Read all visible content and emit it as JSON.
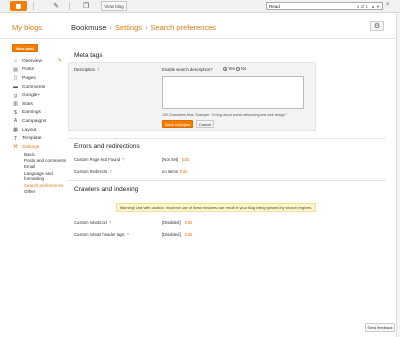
{
  "topbar": {
    "view_blog": "View blog",
    "find_value": "Read",
    "find_count": "1 of 1"
  },
  "header": {
    "my_blogs": "My blogs",
    "blog_name": "Bookmuse",
    "sep1": "›",
    "settings": "Settings",
    "sep2": "›",
    "page": "Search preferences"
  },
  "sidebar": {
    "new_post": "New post",
    "items": [
      {
        "label": "Overview",
        "icon": "home-icon"
      },
      {
        "label": "Posts",
        "icon": "posts-icon"
      },
      {
        "label": "Pages",
        "icon": "pages-icon"
      },
      {
        "label": "Comments",
        "icon": "comments-icon"
      },
      {
        "label": "Google+",
        "icon": "googleplus-icon"
      },
      {
        "label": "Stats",
        "icon": "stats-icon"
      },
      {
        "label": "Earnings",
        "icon": "earnings-icon"
      },
      {
        "label": "Campaigns",
        "icon": "campaigns-icon"
      },
      {
        "label": "Layout",
        "icon": "layout-icon"
      },
      {
        "label": "Template",
        "icon": "template-icon"
      },
      {
        "label": "Settings",
        "icon": "wrench-icon"
      }
    ],
    "sub": [
      "Basic",
      "Posts and comments",
      "Email",
      "Language and formatting",
      "Search preferences",
      "Other"
    ]
  },
  "meta": {
    "title": "Meta tags",
    "desc_label": "Description",
    "help": "?",
    "enable_q": "Enable search description?",
    "yes": "Yes",
    "no": "No",
    "char_hint": "150 Characters Max. Example: \"A blog about social networking and web design.\"",
    "save": "Save changes",
    "cancel": "Cancel"
  },
  "errors": {
    "title": "Errors and redirections",
    "rows": [
      {
        "label": "Custom Page Not Found",
        "help": "?",
        "value": "[Not Set]",
        "edit": "Edit"
      },
      {
        "label": "Custom Redirects",
        "help": "?",
        "value": "no items",
        "edit": "Edit"
      }
    ]
  },
  "crawlers": {
    "title": "Crawlers and indexing",
    "warning": "Warning! Use with caution. Incorrect use of these features can result in your blog being ignored by search engines.",
    "rows": [
      {
        "label": "Custom robots.txt",
        "help": "?",
        "value": "[Disabled]",
        "edit": "Edit"
      },
      {
        "label": "Custom robots header tags",
        "help": "?",
        "value": "[Disabled]",
        "edit": "Edit"
      }
    ]
  },
  "feedback": "Send feedback",
  "colors": {
    "accent": "#f57d00",
    "link": "#e07a1b"
  }
}
